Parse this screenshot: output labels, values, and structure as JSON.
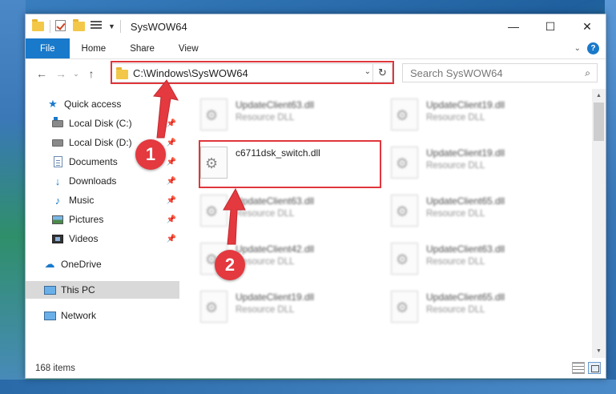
{
  "window": {
    "title": "SysWOW64",
    "controls": {
      "minimize": "—",
      "maximize": "☐",
      "close": "✕"
    }
  },
  "ribbon": {
    "tabs": [
      {
        "label": "File",
        "active": true
      },
      {
        "label": "Home"
      },
      {
        "label": "Share"
      },
      {
        "label": "View"
      }
    ],
    "help": "?"
  },
  "navbar": {
    "back": "←",
    "forward": "→",
    "recent": "⌄",
    "up": "↑",
    "address": "C:\\Windows\\SysWOW64",
    "refresh": "↻",
    "search_placeholder": "Search SysWOW64",
    "search_icon": "⌕"
  },
  "navpane": {
    "items": [
      {
        "label": "Quick access",
        "icon": "star-icon"
      },
      {
        "label": "Local Disk (C:)",
        "icon": "drive-icon",
        "pinned": true
      },
      {
        "label": "Local Disk (D:)",
        "icon": "drive-icon",
        "pinned": true
      },
      {
        "label": "Documents",
        "icon": "document-icon",
        "pinned": true
      },
      {
        "label": "Downloads",
        "icon": "download-icon",
        "pinned": true
      },
      {
        "label": "Music",
        "icon": "music-icon",
        "pinned": true
      },
      {
        "label": "Pictures",
        "icon": "picture-icon",
        "pinned": true
      },
      {
        "label": "Videos",
        "icon": "video-icon",
        "pinned": true
      },
      {
        "label": "OneDrive",
        "icon": "cloud-icon"
      },
      {
        "label": "This PC",
        "icon": "pc-icon",
        "selected": true
      },
      {
        "label": "Network",
        "icon": "network-icon"
      }
    ],
    "pin_glyph": "📌"
  },
  "files": {
    "left": [
      {
        "name": "UpdateClient63.dll",
        "type": "Resource DLL"
      },
      {
        "name": "c6711dsk_switch.dll",
        "type": ""
      },
      {
        "name": "UpdateClient63.dll",
        "type": "Resource DLL"
      },
      {
        "name": "UpdateClient42.dll",
        "type": "Resource DLL"
      },
      {
        "name": "UpdateClient19.dll",
        "type": "Resource DLL"
      }
    ],
    "right": [
      {
        "name": "UpdateClient19.dll",
        "type": "Resource DLL"
      },
      {
        "name": "UpdateClient19.dll",
        "type": "Resource DLL"
      },
      {
        "name": "UpdateClient65.dll",
        "type": "Resource DLL"
      },
      {
        "name": "UpdateClient63.dll",
        "type": "Resource DLL"
      },
      {
        "name": "UpdateClient65.dll",
        "type": "Resource DLL"
      }
    ]
  },
  "status": {
    "item_count": "168 items"
  },
  "annotations": {
    "badge1": "1",
    "badge2": "2",
    "color": "#e3393f"
  },
  "colors": {
    "accent": "#1979ca",
    "highlight": "#e0363c"
  }
}
